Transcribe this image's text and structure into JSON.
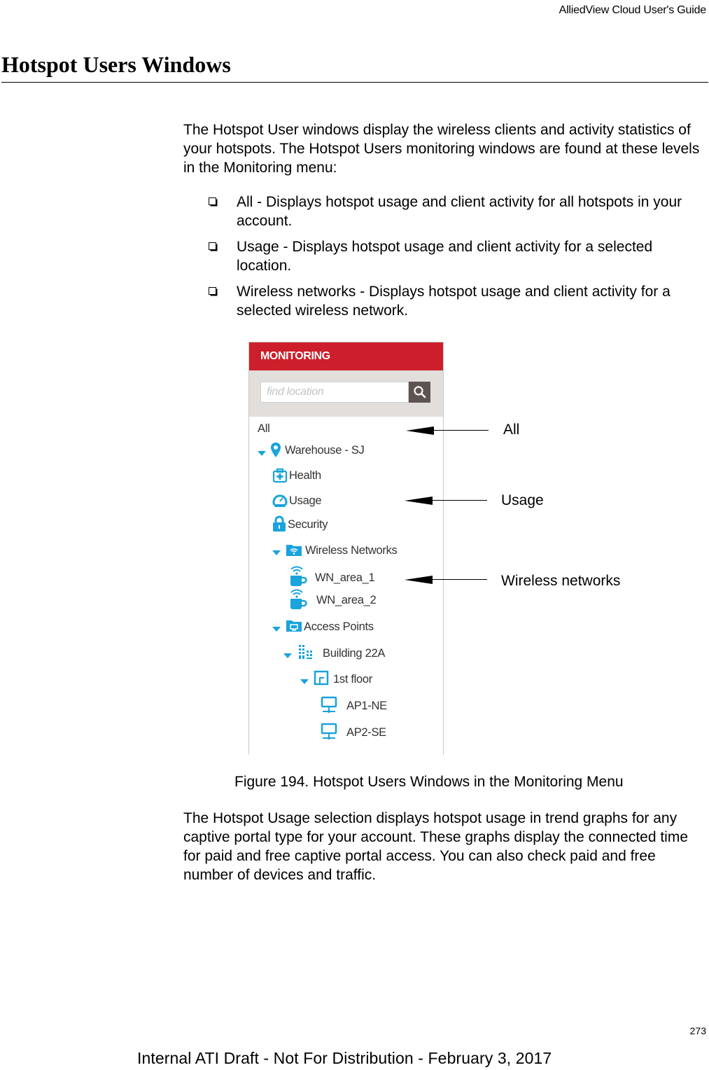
{
  "running_header": "AlliedView Cloud User's Guide",
  "page_title": "Hotspot Users Windows",
  "intro": "The Hotspot User windows display the wireless clients and activity statistics of your hotspots. The Hotspot Users monitoring windows are found at these levels in the Monitoring menu:",
  "bullets": [
    "All - Displays hotspot usage and client activity for all hotspots in your account.",
    "Usage - Displays hotspot usage and client activity for a selected location.",
    "Wireless networks - Displays hotspot usage and client activity for a selected wireless network."
  ],
  "figure": {
    "panel": {
      "header": "MONITORING",
      "header_color": "#cd1f2b",
      "icon_color": "#1aa3dc",
      "search_placeholder": "find location",
      "search_icon": "search-icon",
      "tree": [
        {
          "label": "All",
          "icon": null,
          "expanded": null
        },
        {
          "label": "Warehouse - SJ",
          "icon": "location-pin-icon",
          "expanded": true
        },
        {
          "label": "Health",
          "icon": "health-kit-icon",
          "expanded": null
        },
        {
          "label": "Usage",
          "icon": "speedometer-icon",
          "expanded": null
        },
        {
          "label": "Security",
          "icon": "lock-icon",
          "expanded": null
        },
        {
          "label": "Wireless Networks",
          "icon": "wifi-folder-icon",
          "expanded": true
        },
        {
          "label": "WN_area_1",
          "icon": "wifi-hotspot-cup-icon",
          "expanded": null
        },
        {
          "label": "WN_area_2",
          "icon": "wifi-hotspot-cup-icon",
          "expanded": null
        },
        {
          "label": "Access Points",
          "icon": "ap-folder-icon",
          "expanded": true
        },
        {
          "label": "Building 22A",
          "icon": "building-icon",
          "expanded": true
        },
        {
          "label": "1st floor",
          "icon": "floor-icon",
          "expanded": true
        },
        {
          "label": "AP1-NE",
          "icon": "access-point-icon",
          "expanded": null
        },
        {
          "label": "AP2-SE",
          "icon": "access-point-icon",
          "expanded": null
        }
      ]
    },
    "callouts": [
      "All",
      "Usage",
      "Wireless networks"
    ],
    "caption": "Figure 194. Hotspot Users Windows in the Monitoring Menu"
  },
  "body_after_figure": "The Hotspot Usage selection displays hotspot usage in trend graphs for any captive portal type for your account. These graphs display the connected time for paid and free captive portal access. You can also check paid and free number of devices and traffic.",
  "page_number": "273",
  "footer": "Internal ATI Draft - Not For Distribution - February 3, 2017"
}
